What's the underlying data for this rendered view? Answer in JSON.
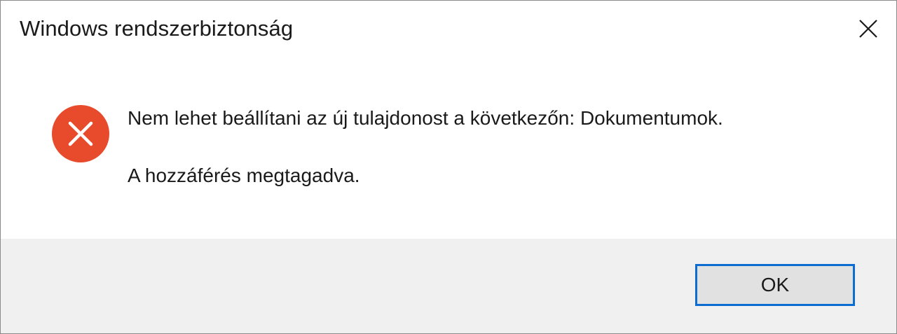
{
  "window": {
    "title": "Windows rendszerbiztonság",
    "close_icon": "close-icon"
  },
  "message": {
    "icon": "error-icon",
    "line1": "Nem lehet beállítani az új tulajdonost a következőn: Dokumentumok.",
    "line2": "A hozzáférés megtagadva."
  },
  "buttons": {
    "ok_label": "OK"
  },
  "colors": {
    "error_red": "#e81123",
    "accent_blue": "#0d6cd0",
    "footer_bg": "#f0f0f0"
  }
}
